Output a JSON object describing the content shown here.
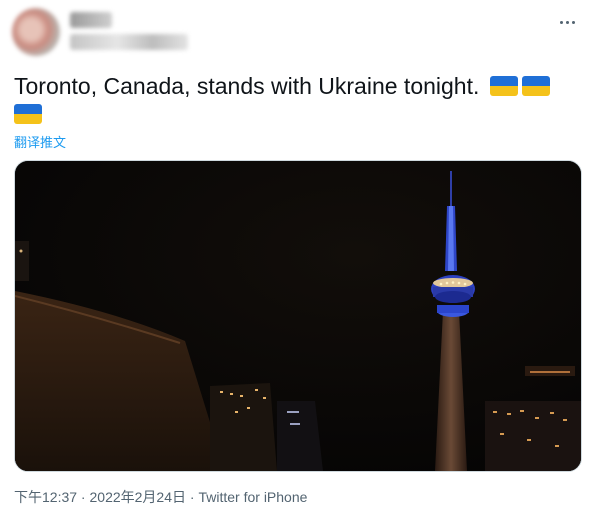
{
  "tweet": {
    "text": "Toronto, Canada, stands with Ukraine tonight.",
    "emoji": [
      "ukraine-flag",
      "ukraine-flag",
      "ukraine-flag"
    ],
    "translate_label": "翻译推文"
  },
  "footer": {
    "time": "下午12:37",
    "sep1": " · ",
    "date": "2022年2月24日",
    "sep2": " · ",
    "source": "Twitter for iPhone"
  },
  "colors": {
    "link": "#1d9bf0",
    "text": "#0f1419",
    "meta": "#536471",
    "flag_blue": "#1f6fd6",
    "flag_yellow": "#f4c21a",
    "tower_blue": "#3a5bd8"
  },
  "icons": {
    "more": "more-horizontal-icon"
  }
}
